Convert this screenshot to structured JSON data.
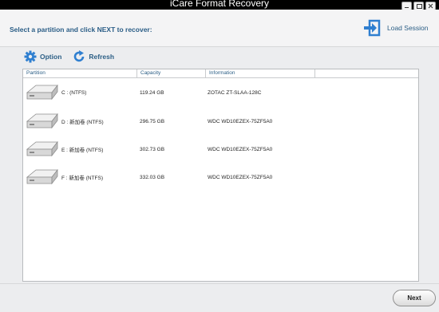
{
  "window": {
    "title": "iCare Format Recovery"
  },
  "header": {
    "prompt": "Select a partition and click NEXT to recover:",
    "load_session": "Load Session"
  },
  "toolbar": {
    "option": "Option",
    "refresh": "Refresh"
  },
  "table": {
    "columns": [
      "Partition",
      "Capacity",
      "Information"
    ],
    "rows": [
      {
        "partition": "C :  (NTFS)",
        "capacity": "119.24 GB",
        "information": "ZOTAC   ZT-SLAA-128C"
      },
      {
        "partition": "D : 新加卷  (NTFS)",
        "capacity": "296.75 GB",
        "information": "WDC   WD10EZEX-75ZF5A0"
      },
      {
        "partition": "E : 新加卷  (NTFS)",
        "capacity": "302.73 GB",
        "information": "WDC   WD10EZEX-75ZF5A0"
      },
      {
        "partition": "F : 新加卷  (NTFS)",
        "capacity": "332.03 GB",
        "information": "WDC   WD10EZEX-75ZF5A0"
      }
    ]
  },
  "footer": {
    "next": "Next"
  },
  "colors": {
    "accent_text": "#2c5f86",
    "icon_blue": "#2f7fd0",
    "titlebar": "#000000"
  },
  "icons": [
    "minimize-icon",
    "maximize-icon",
    "close-icon",
    "load-session-icon",
    "gear-icon",
    "refresh-icon",
    "hard-drive-icon"
  ]
}
